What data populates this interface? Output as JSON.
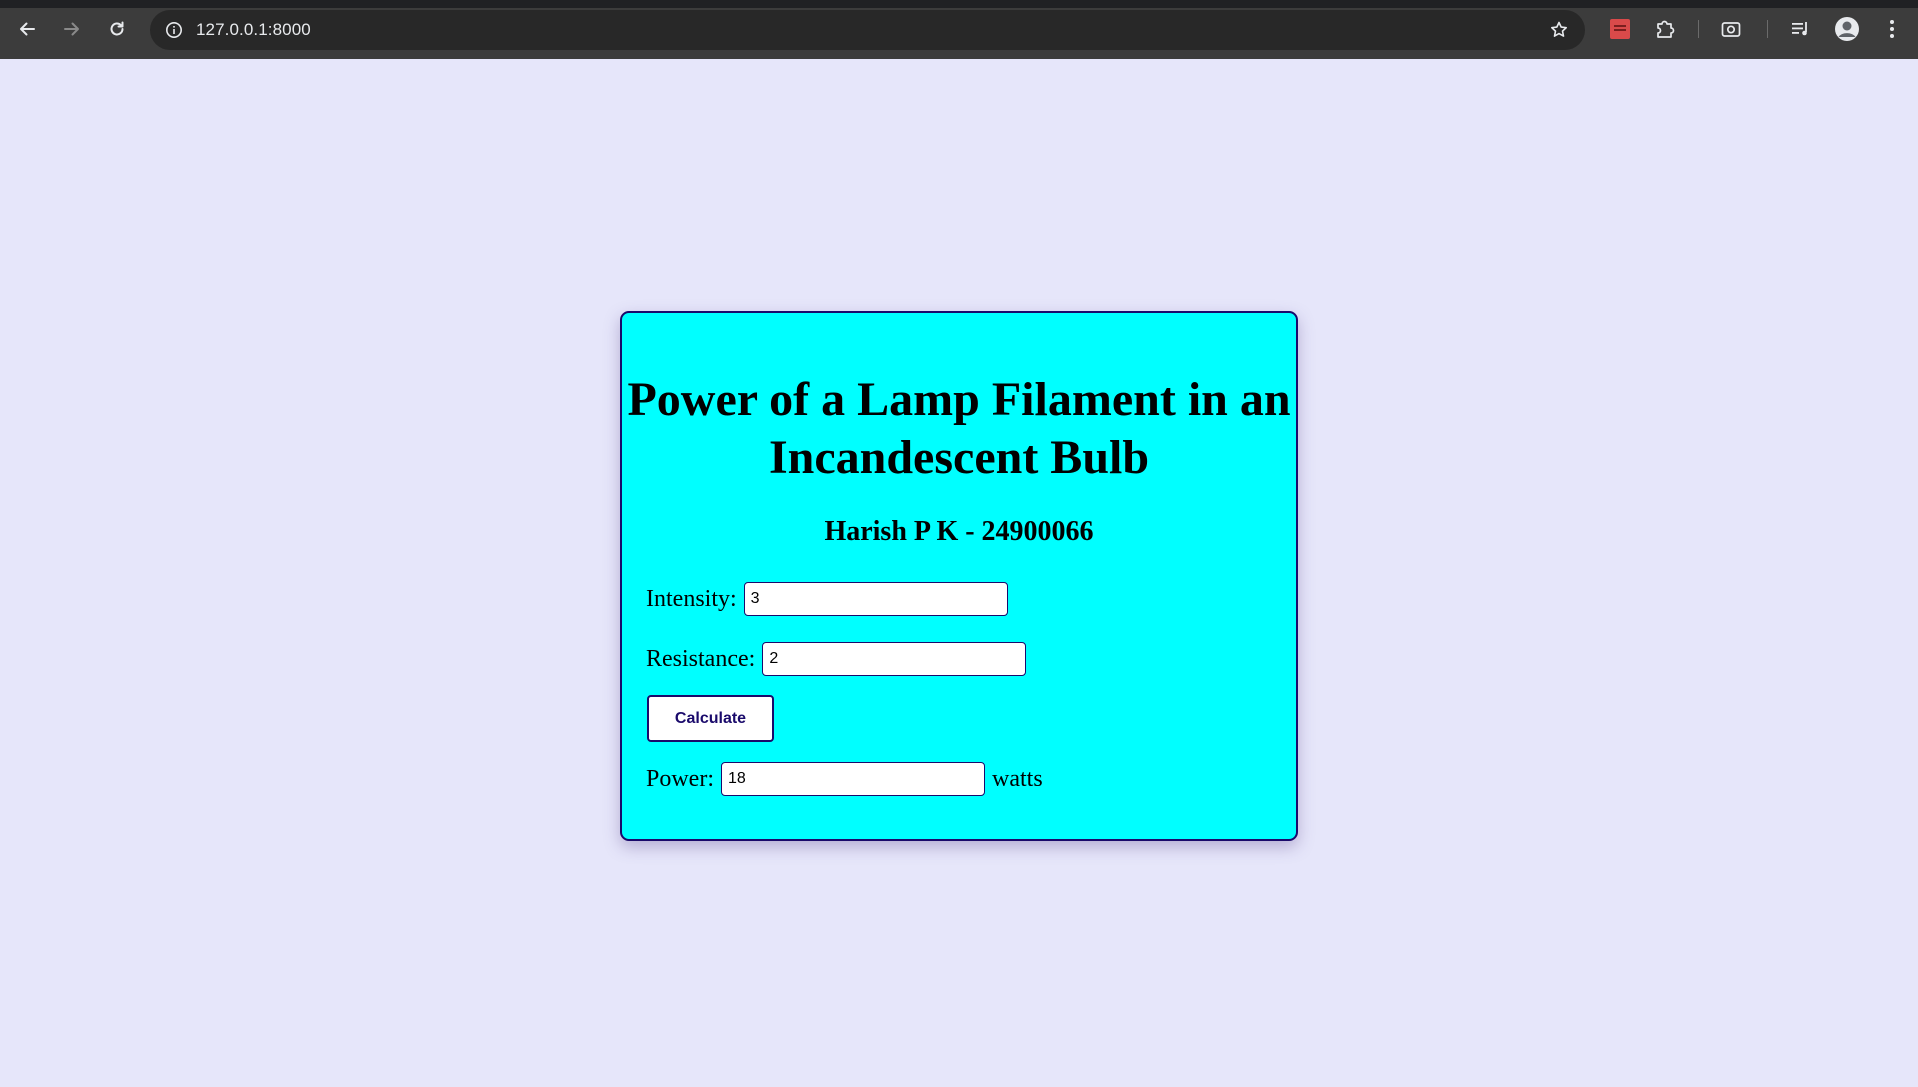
{
  "browser": {
    "url": "127.0.0.1:8000",
    "icons": {
      "back": "back-arrow-icon",
      "forward": "forward-arrow-icon",
      "reload": "reload-icon",
      "site_info": "info-icon",
      "bookmark": "star-icon",
      "extension_red": "red-extension-icon",
      "extensions": "puzzle-icon",
      "screenshot": "camera-icon",
      "media": "media-queue-icon",
      "profile": "avatar-icon",
      "menu": "kebab-menu-icon"
    }
  },
  "page": {
    "title": "Power of a Lamp Filament in an Incandescent Bulb",
    "subtitle": "Harish P K - 24900066",
    "intensity": {
      "label": "Intensity:",
      "value": "3"
    },
    "resistance": {
      "label": "Resistance:",
      "value": "2"
    },
    "calculate_label": "Calculate",
    "power": {
      "label": "Power:",
      "value": "18",
      "unit": "watts"
    }
  },
  "colors": {
    "page_background": "#e6e6fa",
    "card_background": "#00ffff",
    "card_border": "#1a0a6b",
    "button_text": "#1a0a6b"
  }
}
